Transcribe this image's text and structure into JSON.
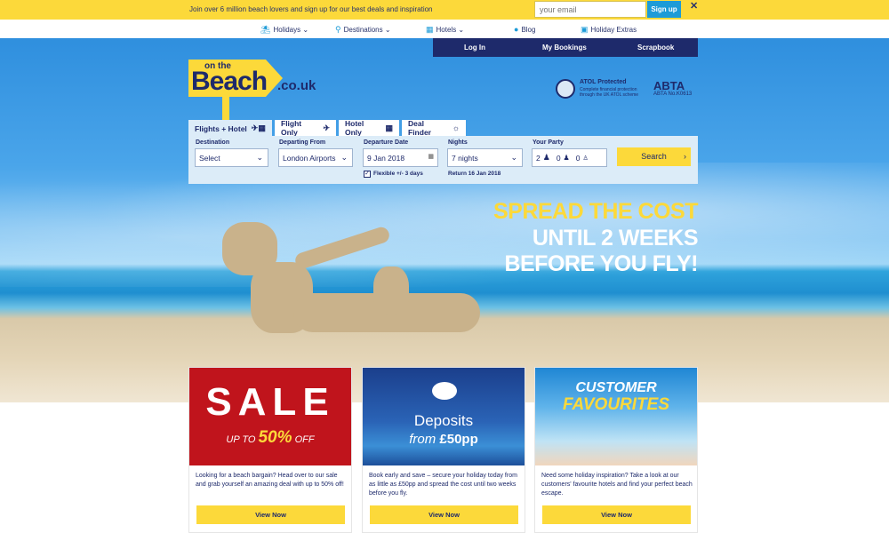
{
  "promo": {
    "text": "Join over 6 million beach lovers and sign up for our best deals and inspiration",
    "email_placeholder": "your email",
    "signup_label": "Sign up",
    "close_label": "✕"
  },
  "nav": {
    "items": [
      {
        "label": "Holidays ⌄",
        "icon": "palm-icon"
      },
      {
        "label": "Destinations ⌄",
        "icon": "pin-icon"
      },
      {
        "label": "Hotels ⌄",
        "icon": "building-icon"
      },
      {
        "label": "Blog",
        "icon": "chat-icon"
      },
      {
        "label": "Holiday Extras",
        "icon": "suitcase-icon"
      }
    ]
  },
  "account": {
    "login": "Log In",
    "bookings": "My Bookings",
    "scrapbook": "Scrapbook"
  },
  "logo": {
    "on_the": "on the",
    "beach": "Beach",
    "domain": ".co.uk"
  },
  "badges": {
    "atol_title": "ATOL Protected",
    "atol_sub": "Complete financial protection through the UK ATOL scheme",
    "abta": "ABTA",
    "abta_no": "ABTA No.K0613"
  },
  "search": {
    "tabs": [
      {
        "label": "Flights + Hotel",
        "active": true
      },
      {
        "label": "Flight Only",
        "active": false
      },
      {
        "label": "Hotel Only",
        "active": false
      },
      {
        "label": "Deal Finder",
        "active": false
      }
    ],
    "destination_label": "Destination",
    "destination_value": "Select",
    "departing_label": "Departing From",
    "departing_value": "London Airports",
    "date_label": "Departure Date",
    "date_value": "9 Jan 2018",
    "nights_label": "Nights",
    "nights_value": "7 nights",
    "party_label": "Your Party",
    "party_adults": "2",
    "party_children": "0",
    "party_infants": "0",
    "flexible_label": "Flexible +/- 3 days",
    "flexible_checked": true,
    "return_label": "Return 16 Jan 2018",
    "search_label": "Search"
  },
  "headline": {
    "line1": "SPREAD THE COST",
    "line2": "UNTIL 2 WEEKS",
    "line3": "BEFORE YOU FLY!"
  },
  "cards": [
    {
      "title": "SALE",
      "sub_prefix": "UP TO ",
      "sub_pct": "50%",
      "sub_suffix": " OFF",
      "text": "Looking for a beach bargain? Head over to our sale and grab yourself an amazing deal with up to 50% off!",
      "button": "View Now"
    },
    {
      "title": "Deposits",
      "sub_prefix": "from ",
      "sub_amount": "£50pp",
      "text": "Book early and save – secure your holiday today from as little as £50pp and spread the cost until two weeks before you fly.",
      "button": "View Now"
    },
    {
      "title": "CUSTOMER",
      "title2": "FAVOURITES",
      "text": "Need some holiday inspiration? Take a look at our customers' favourite hotels and find your perfect beach escape.",
      "button": "View Now"
    }
  ],
  "colors": {
    "brand_yellow": "#fcd93a",
    "brand_navy": "#1e2a6b",
    "signup_blue": "#1d9bd7",
    "sale_red": "#c0141c"
  }
}
